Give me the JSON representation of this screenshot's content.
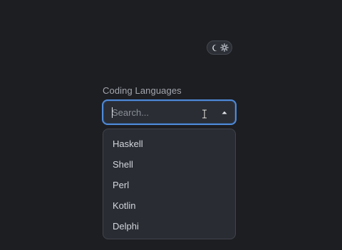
{
  "theme_toggle": {
    "icons": [
      "moon-icon",
      "gear-icon"
    ]
  },
  "field": {
    "label": "Coding Languages",
    "placeholder": "Search...",
    "value": "",
    "expanded": true
  },
  "options": [
    {
      "label": "Haskell"
    },
    {
      "label": "Shell"
    },
    {
      "label": "Perl"
    },
    {
      "label": "Kotlin"
    },
    {
      "label": "Delphi"
    }
  ],
  "colors": {
    "background": "#1d1e22",
    "focus_border": "#4f8ad8",
    "surface": "#2a2d34"
  }
}
